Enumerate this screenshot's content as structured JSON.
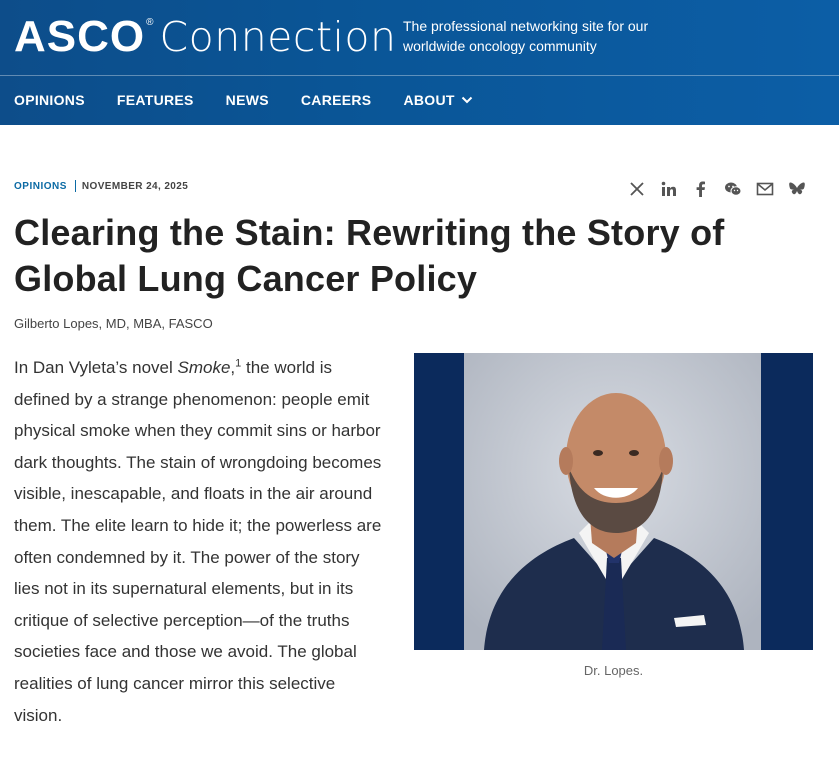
{
  "header": {
    "logo_asco": "ASCO",
    "logo_reg": "®",
    "logo_connection": "Connection",
    "tagline": "The professional networking site for our worldwide oncology community"
  },
  "nav": {
    "items": [
      {
        "label": "OPINIONS"
      },
      {
        "label": "FEATURES"
      },
      {
        "label": "NEWS"
      },
      {
        "label": "CAREERS"
      },
      {
        "label": "ABOUT"
      }
    ]
  },
  "article": {
    "category": "OPINIONS",
    "date": "NOVEMBER 24, 2025",
    "title": "Clearing the Stain: Rewriting the Story of Global Lung Cancer Policy",
    "author": "Gilberto Lopes, MD, MBA, FASCO",
    "body_before": "In Dan Vyleta’s novel ",
    "body_italic": "Smoke",
    "body_sup": "1",
    "body_after": " the world is defined by a strange phenomenon: people emit physical smoke when they commit sins or harbor dark thoughts. The stain of wrongdoing becomes visible, inescapable, and floats in the air around them. The elite learn to hide it; the powerless are often condemned by it. The power of the story lies not in its supernatural elements, but in its critique of selective perception—of the truths societies face and those we avoid. The global realities of lung cancer mirror this selective vision.",
    "caption": "Dr. Lopes."
  },
  "share": {
    "icons": [
      "x-icon",
      "linkedin-icon",
      "facebook-icon",
      "wechat-icon",
      "email-icon",
      "bluesky-icon"
    ]
  },
  "colors": {
    "header_bg": "#0a5596",
    "category": "#0b6aa4",
    "photo_frame": "#0b2a5c"
  }
}
